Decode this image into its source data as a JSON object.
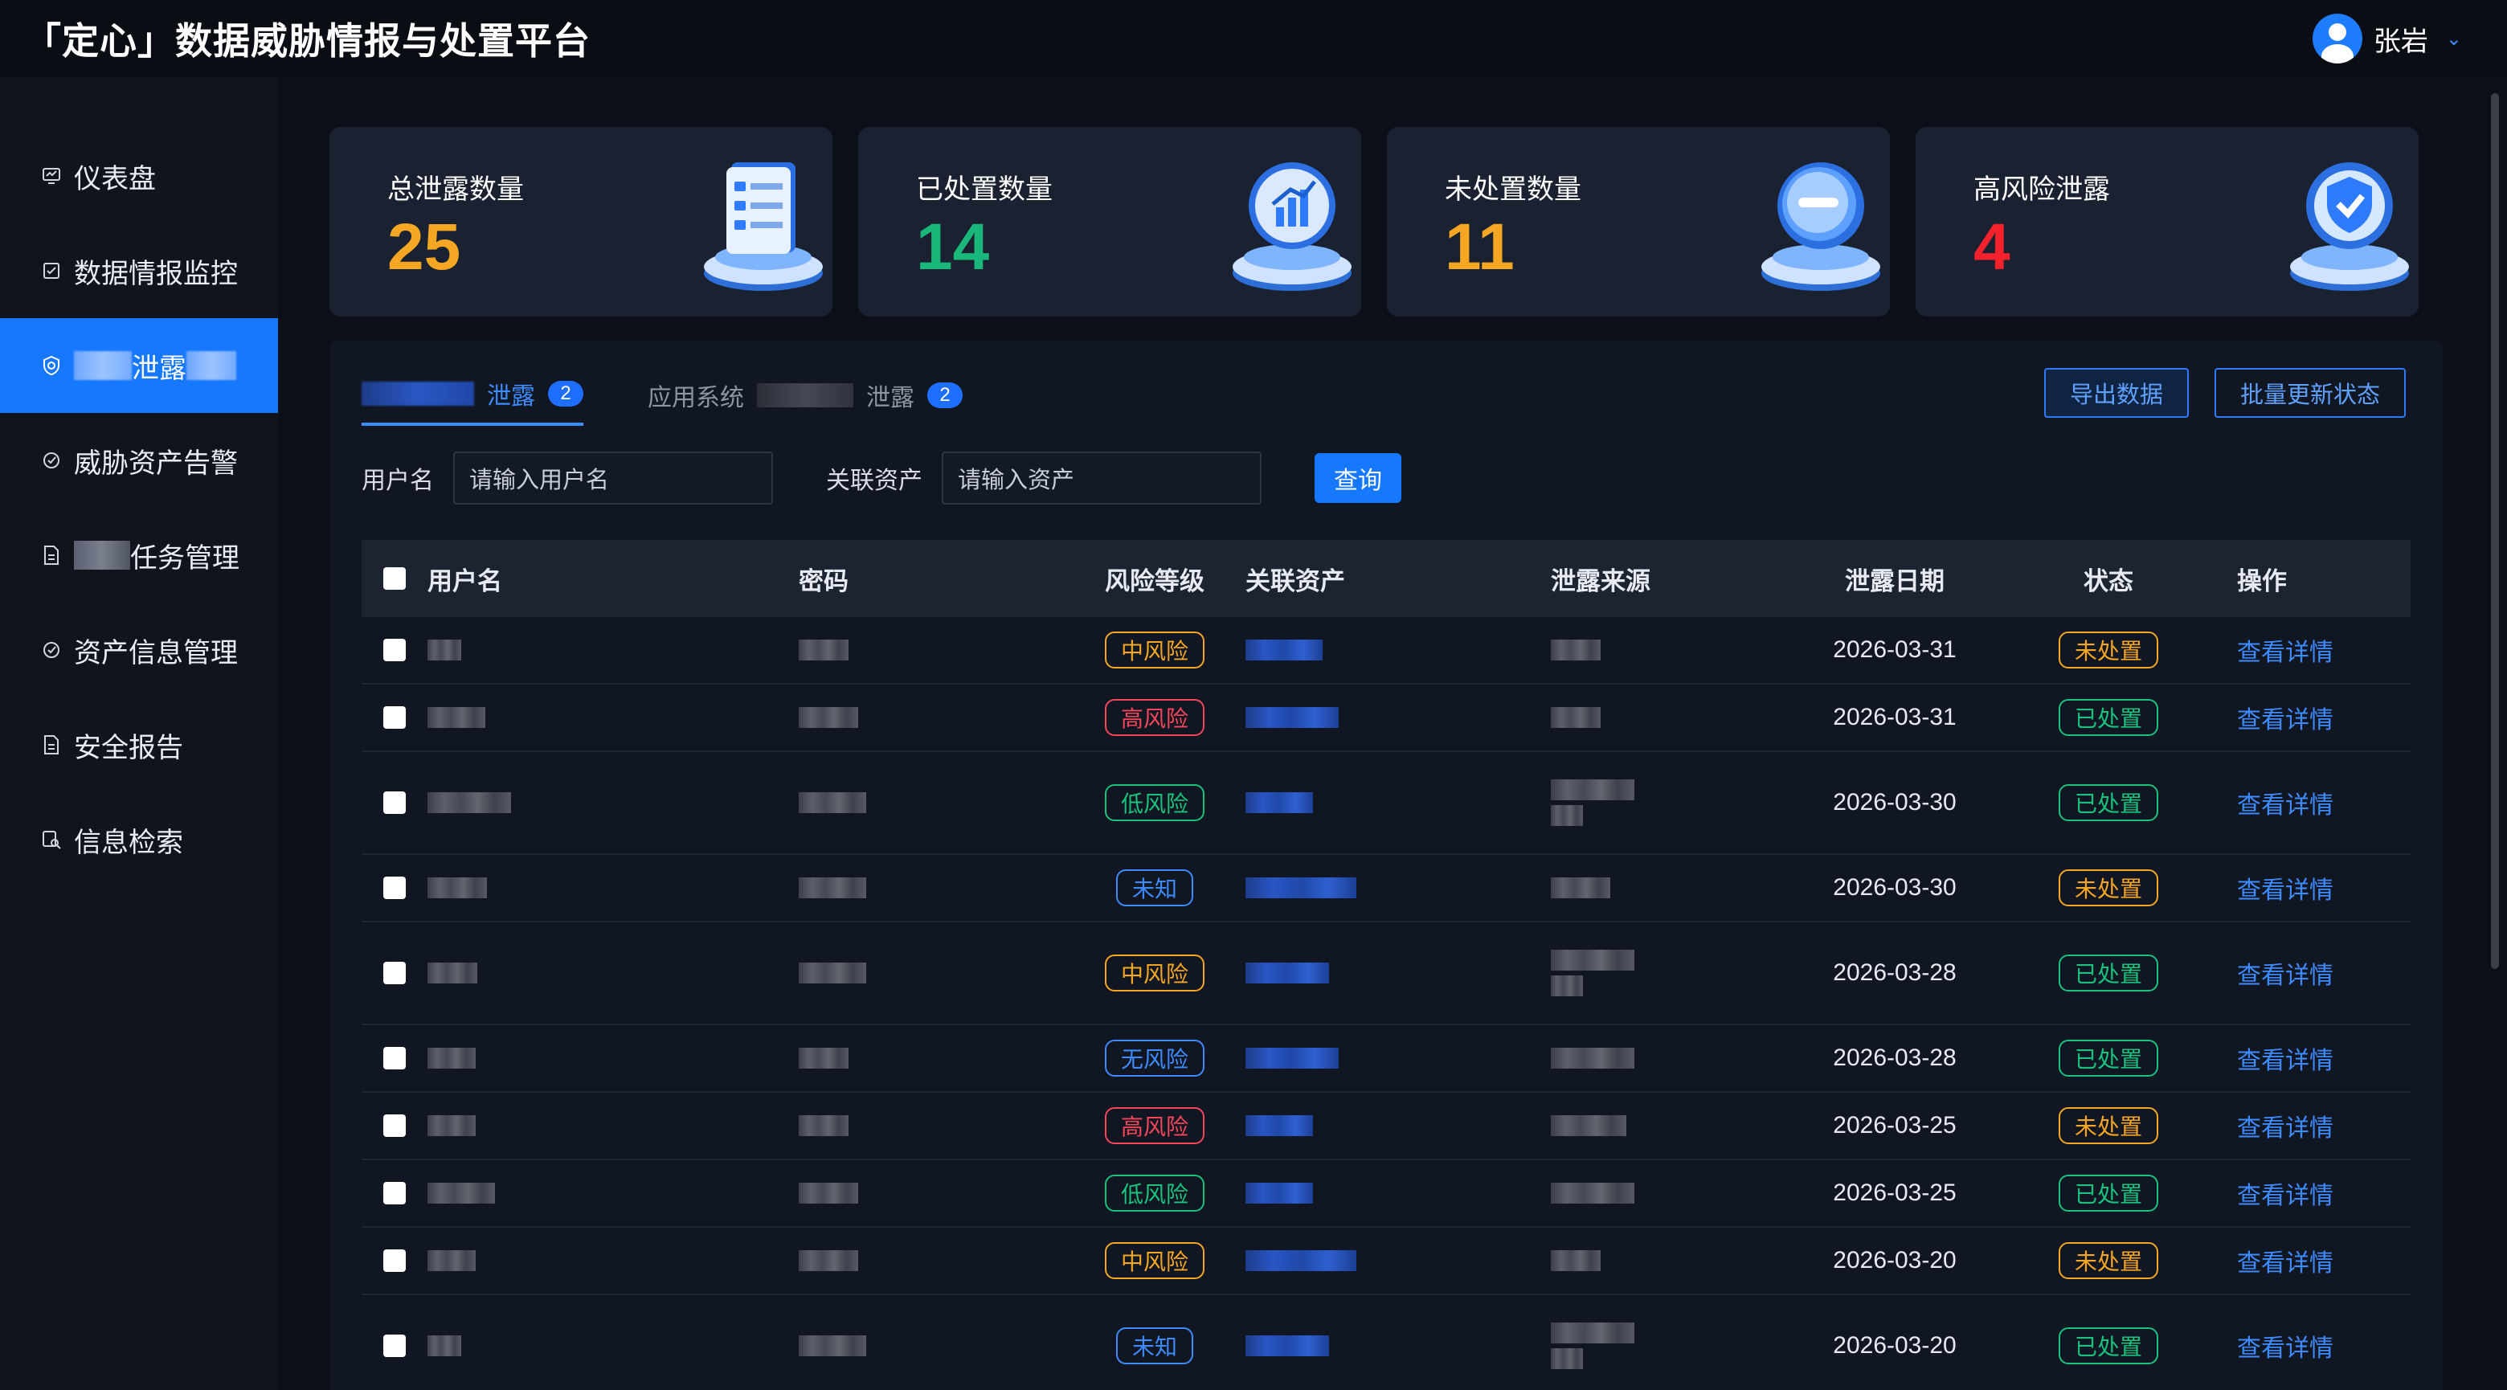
{
  "header": {
    "title": "「定心」数据威胁情报与处置平台",
    "user_name": "张岩"
  },
  "sidebar": {
    "items": [
      {
        "label": "仪表盘",
        "icon": "dashboard-icon"
      },
      {
        "label": "数据情报监控",
        "icon": "monitor-icon"
      },
      {
        "label": "泄露",
        "icon": "shield-icon",
        "active": true
      },
      {
        "label": "威胁资产告警",
        "icon": "alert-icon"
      },
      {
        "label": "任务管理",
        "icon": "document-icon"
      },
      {
        "label": "资产信息管理",
        "icon": "gear-icon"
      },
      {
        "label": "安全报告",
        "icon": "report-icon"
      },
      {
        "label": "信息检索",
        "icon": "search-icon"
      }
    ]
  },
  "stats": [
    {
      "label": "总泄露数量",
      "value": "25",
      "color": "#f5a623",
      "icon": "checklist-icon"
    },
    {
      "label": "已处置数量",
      "value": "14",
      "color": "#19b77a",
      "icon": "chart-icon"
    },
    {
      "label": "未处置数量",
      "value": "11",
      "color": "#f5a623",
      "icon": "minus-circle-icon"
    },
    {
      "label": "高风险泄露",
      "value": "4",
      "color": "#f5222d",
      "icon": "check-shield-icon"
    }
  ],
  "tabs": [
    {
      "label": "泄露",
      "badge": "2",
      "active": true
    },
    {
      "label_prefix": "应用系统",
      "label_suffix": "泄露",
      "badge": "2",
      "active": false
    }
  ],
  "actions": {
    "export": "导出数据",
    "batch_update": "批量更新状态"
  },
  "filters": {
    "username_label": "用户名",
    "username_placeholder": "请输入用户名",
    "asset_label": "关联资产",
    "asset_placeholder": "请输入资产",
    "query_button": "查询"
  },
  "table": {
    "columns": [
      "用户名",
      "密码",
      "风险等级",
      "关联资产",
      "泄露来源",
      "泄露日期",
      "状态",
      "操作"
    ],
    "rows": [
      {
        "risk": "中风险",
        "date": "2026-03-31",
        "status": "未处置",
        "action": "查看详情"
      },
      {
        "risk": "高风险",
        "date": "2026-03-31",
        "status": "已处置",
        "action": "查看详情"
      },
      {
        "risk": "低风险",
        "date": "2026-03-30",
        "status": "已处置",
        "action": "查看详情"
      },
      {
        "risk": "未知",
        "date": "2026-03-30",
        "status": "未处置",
        "action": "查看详情"
      },
      {
        "risk": "中风险",
        "date": "2026-03-28",
        "status": "已处置",
        "action": "查看详情"
      },
      {
        "risk": "无风险",
        "date": "2026-03-28",
        "status": "已处置",
        "action": "查看详情"
      },
      {
        "risk": "高风险",
        "date": "2026-03-25",
        "status": "未处置",
        "action": "查看详情"
      },
      {
        "risk": "低风险",
        "date": "2026-03-25",
        "status": "已处置",
        "action": "查看详情"
      },
      {
        "risk": "中风险",
        "date": "2026-03-20",
        "status": "未处置",
        "action": "查看详情"
      },
      {
        "risk": "未知",
        "date": "2026-03-20",
        "status": "已处置",
        "action": "查看详情"
      }
    ]
  },
  "colors": {
    "risk": {
      "中风险": "#f5a623",
      "高风险": "#f5465a",
      "低风险": "#19c37d",
      "未知": "#3d8bff",
      "无风险": "#3d8bff"
    },
    "status": {
      "未处置": "#f5a623",
      "已处置": "#19c37d"
    }
  }
}
